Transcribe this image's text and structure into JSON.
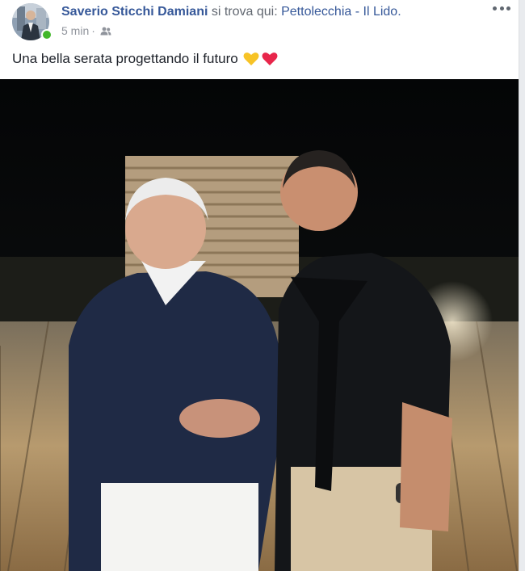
{
  "post": {
    "author": "Saverio Sticchi Damiani",
    "checkin_text": " si trova qui: ",
    "place": "Pettolecchia - Il Lido.",
    "timestamp": "5 min",
    "separator": "·",
    "audience_icon": "friends-icon",
    "more_icon": "more-options-icon",
    "text": "Una bella serata progettando il futuro",
    "emojis": [
      "yellow-heart-icon",
      "red-heart-icon"
    ]
  },
  "colors": {
    "link": "#365899",
    "secondary_text": "#90949c",
    "online": "#42b72a"
  }
}
